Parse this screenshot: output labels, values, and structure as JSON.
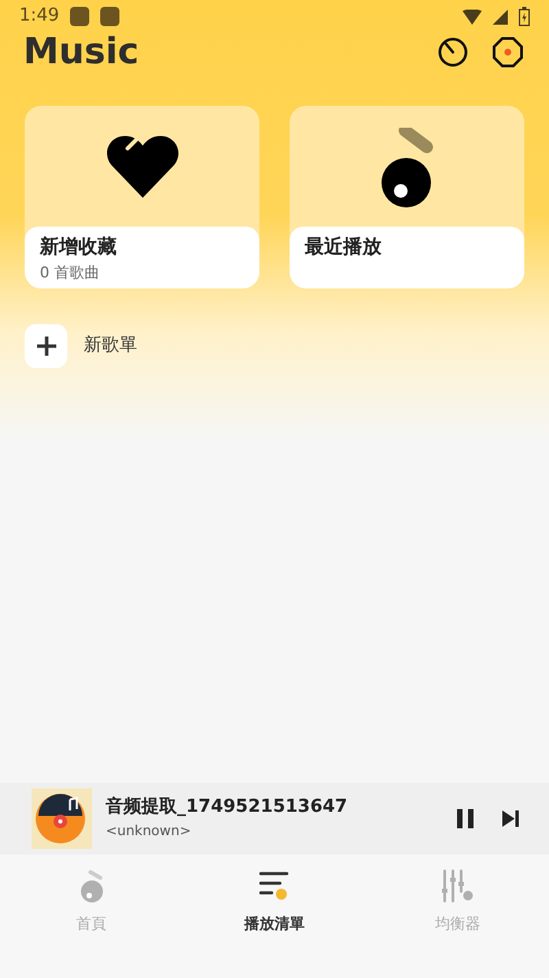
{
  "status_bar": {
    "time": "1:49"
  },
  "header": {
    "title": "Music"
  },
  "cards": [
    {
      "kind": "favorites",
      "title": "新增收藏",
      "subtitle": "0 首歌曲"
    },
    {
      "kind": "recent",
      "title": "最近播放"
    }
  ],
  "new_playlist": {
    "label": "新歌單"
  },
  "now_playing": {
    "title": "音频提取_1749521513647",
    "artist": "<unknown>",
    "playing": true
  },
  "nav": [
    {
      "kind": "home",
      "label": "首頁",
      "selected": false
    },
    {
      "kind": "playlist",
      "label": "播放清單",
      "selected": true
    },
    {
      "kind": "equalizer",
      "label": "均衡器",
      "selected": false
    }
  ]
}
